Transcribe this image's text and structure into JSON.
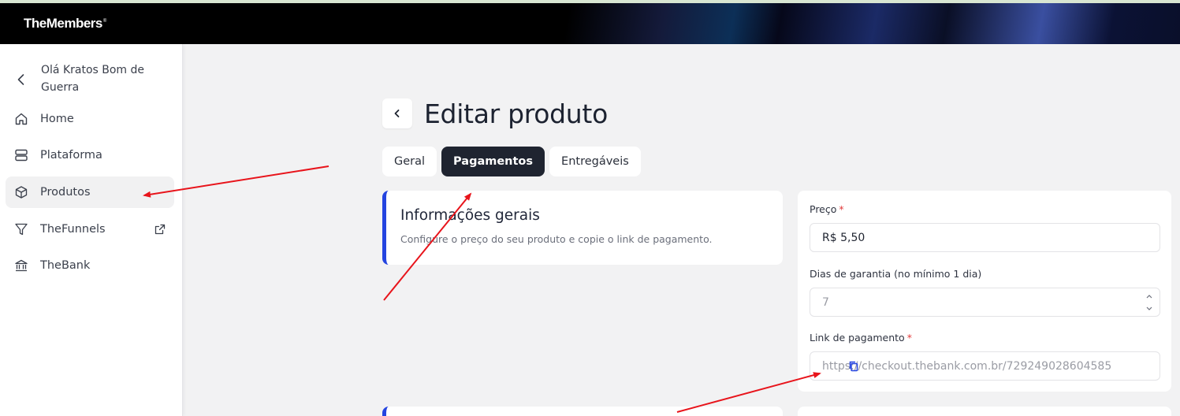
{
  "app": {
    "brand": "TheMembers",
    "brand_mark": "®"
  },
  "sidebar": {
    "greeting": "Olá Kratos Bom de Guerra",
    "items": [
      {
        "label": "Home",
        "icon": "home-icon"
      },
      {
        "label": "Plataforma",
        "icon": "server-icon"
      },
      {
        "label": "Produtos",
        "icon": "box-icon",
        "active": true
      },
      {
        "label": "TheFunnels",
        "icon": "funnel-icon",
        "external": true
      },
      {
        "label": "TheBank",
        "icon": "bank-icon"
      }
    ]
  },
  "main": {
    "title": "Editar produto",
    "tabs": [
      {
        "label": "Geral"
      },
      {
        "label": "Pagamentos",
        "active": true
      },
      {
        "label": "Entregáveis"
      }
    ],
    "info_card": {
      "title": "Informações gerais",
      "description": "Configure o preço do seu produto e copie o link de pagamento."
    },
    "form": {
      "price_label": "Preço",
      "price_value": "R$ 5,50",
      "guarantee_label": "Dias de garantia (no mínimo 1 dia)",
      "guarantee_value": "7",
      "link_label": "Link de pagamento",
      "link_value": "https://checkout.thebank.com.br/729249028604585",
      "required_mark": "*"
    }
  },
  "colors": {
    "accent": "#2444e0",
    "active_tab": "#1f2430",
    "required": "#e23b3b",
    "annotation_arrow": "#e8141b"
  }
}
